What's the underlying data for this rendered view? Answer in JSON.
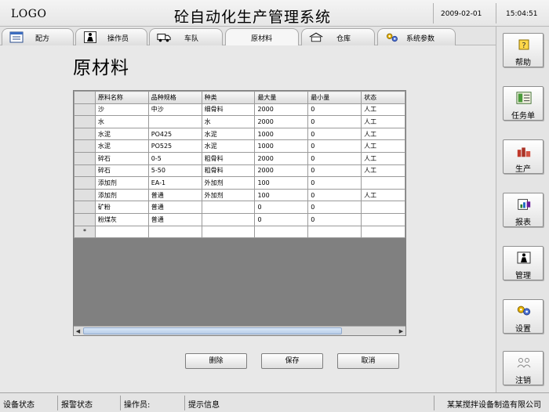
{
  "header": {
    "logo": "LOGO",
    "title": "砼自动化生产管理系统",
    "date": "2009-02-01",
    "time": "15:04:51"
  },
  "tabs": [
    {
      "label": "配方",
      "icon": "recipe-icon"
    },
    {
      "label": "操作员",
      "icon": "operator-icon"
    },
    {
      "label": "车队",
      "icon": "truck-icon"
    },
    {
      "label": "原材料",
      "icon": "",
      "active": true
    },
    {
      "label": "仓库",
      "icon": "warehouse-icon"
    },
    {
      "label": "系统参数",
      "icon": "gears-icon"
    }
  ],
  "sidebar": [
    {
      "label": "帮助",
      "icon": "help-icon"
    },
    {
      "label": "任务单",
      "icon": "task-list-icon"
    },
    {
      "label": "生产",
      "icon": "production-icon"
    },
    {
      "label": "报表",
      "icon": "report-icon"
    },
    {
      "label": "管理",
      "icon": "manage-icon"
    },
    {
      "label": "设置",
      "icon": "settings-icon"
    },
    {
      "label": "注销",
      "icon": "logout-icon"
    }
  ],
  "page_title": "原材料",
  "table": {
    "columns": [
      "原料名称",
      "品种规格",
      "种类",
      "最大量",
      "最小量",
      "状态"
    ],
    "rows": [
      [
        "沙",
        "中沙",
        "细骨料",
        "2000",
        "0",
        "人工"
      ],
      [
        "水",
        "",
        "水",
        "2000",
        "0",
        "人工"
      ],
      [
        "水泥",
        "PO425",
        "水泥",
        "1000",
        "0",
        "人工"
      ],
      [
        "水泥",
        "PO525",
        "水泥",
        "1000",
        "0",
        "人工"
      ],
      [
        "碎石",
        "0-5",
        "粗骨料",
        "2000",
        "0",
        "人工"
      ],
      [
        "碎石",
        "5-50",
        "粗骨料",
        "2000",
        "0",
        "人工"
      ],
      [
        "添加剂",
        "EA-1",
        "外加剂",
        "100",
        "0",
        ""
      ],
      [
        "添加剂",
        "普通",
        "外加剂",
        "100",
        "0",
        "人工"
      ],
      [
        "矿粉",
        "普通",
        "",
        "0",
        "0",
        ""
      ],
      [
        "粉煤灰",
        "普通",
        "",
        "0",
        "0",
        ""
      ]
    ],
    "new_row_marker": "*"
  },
  "buttons": {
    "delete": "删除",
    "save": "保存",
    "cancel": "取消"
  },
  "status": {
    "device": "设备状态",
    "alarm": "报警状态",
    "operator": "操作员:",
    "hint": "提示信息",
    "company": "某某搅拌设备制造有限公司"
  }
}
